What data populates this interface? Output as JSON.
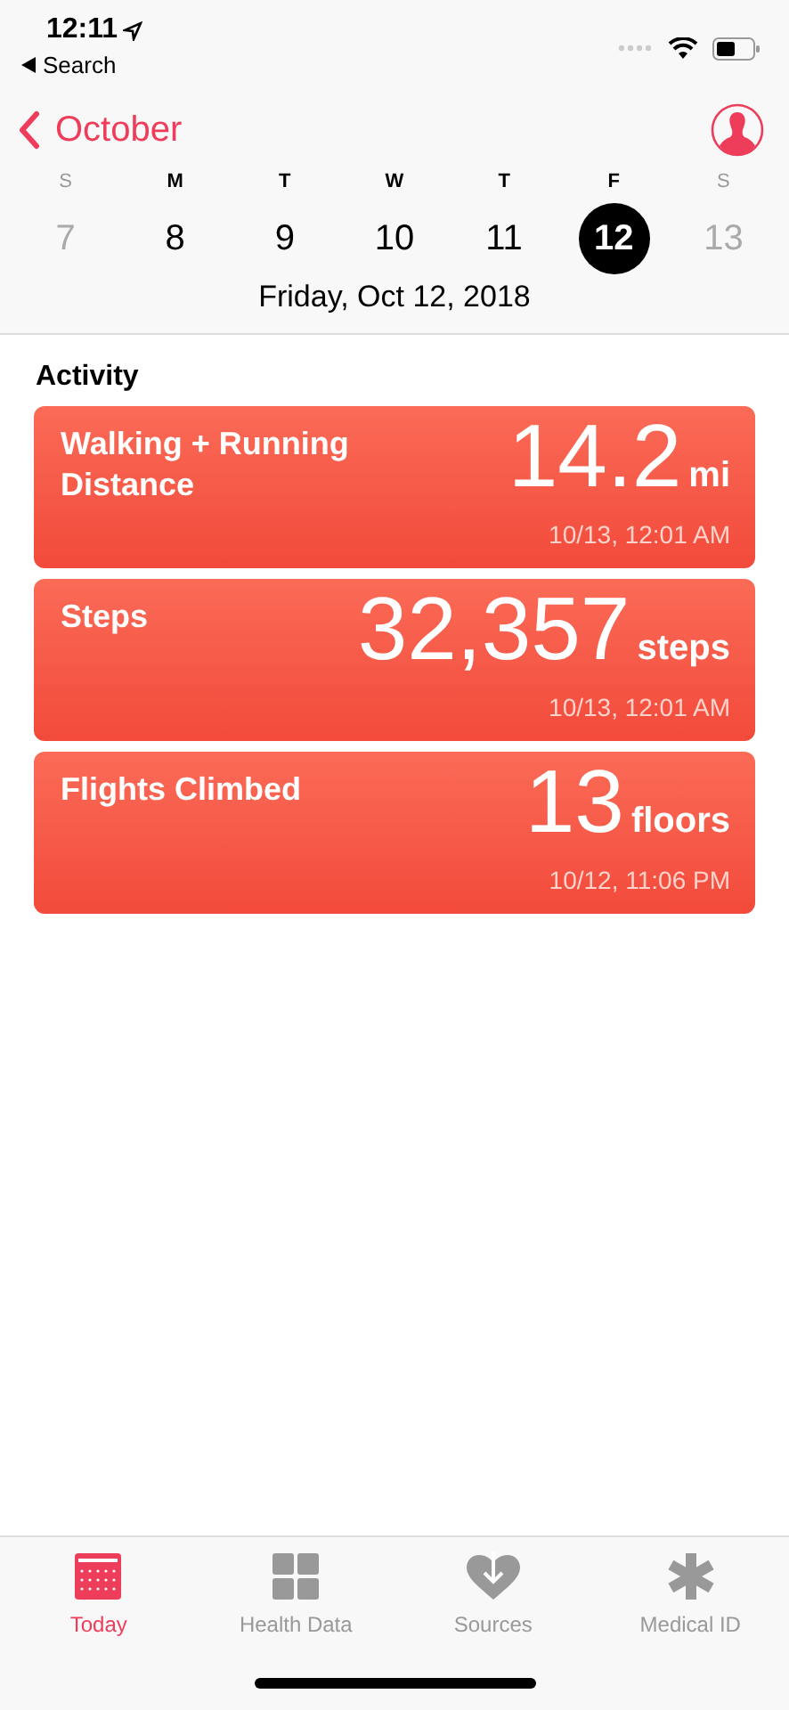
{
  "status_bar": {
    "time": "12:11",
    "back_label": "Search"
  },
  "nav": {
    "back_label": "October"
  },
  "week": [
    {
      "letter": "S",
      "number": "7",
      "muted": true,
      "selected": false
    },
    {
      "letter": "M",
      "number": "8",
      "muted": false,
      "selected": false
    },
    {
      "letter": "T",
      "number": "9",
      "muted": false,
      "selected": false
    },
    {
      "letter": "W",
      "number": "10",
      "muted": false,
      "selected": false
    },
    {
      "letter": "T",
      "number": "11",
      "muted": false,
      "selected": false
    },
    {
      "letter": "F",
      "number": "12",
      "muted": false,
      "selected": true
    },
    {
      "letter": "S",
      "number": "13",
      "muted": true,
      "selected": false
    }
  ],
  "date_label": "Friday, Oct 12, 2018",
  "section_title": "Activity",
  "cards": [
    {
      "title": "Walking + Running Distance",
      "value": "14.2",
      "unit": "mi",
      "time": "10/13, 12:01 AM"
    },
    {
      "title": "Steps",
      "value": "32,357",
      "unit": "steps",
      "time": "10/13, 12:01 AM"
    },
    {
      "title": "Flights Climbed",
      "value": "13",
      "unit": "floors",
      "time": "10/12, 11:06 PM"
    }
  ],
  "tabs": [
    {
      "label": "Today",
      "kind": "calendar",
      "selected": true
    },
    {
      "label": "Health Data",
      "kind": "grid",
      "selected": false
    },
    {
      "label": "Sources",
      "kind": "heart",
      "selected": false
    },
    {
      "label": "Medical ID",
      "kind": "asterisk",
      "selected": false
    }
  ]
}
